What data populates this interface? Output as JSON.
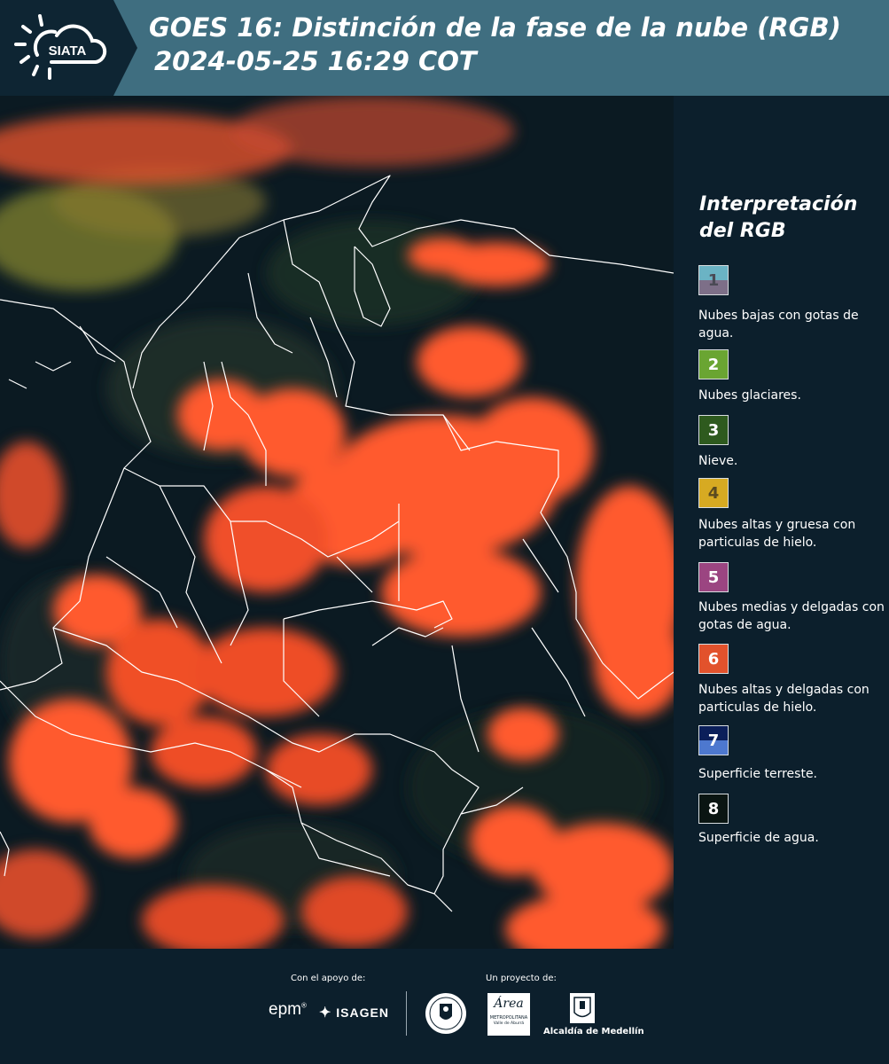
{
  "header": {
    "logo_text": "SIATA",
    "title_line1": "GOES 16: Distinción de la fase de la nube (RGB)",
    "title_line2": "2024-05-25 16:29 COT"
  },
  "legend": {
    "title_line1": "Interpretación",
    "title_line2": "del RGB",
    "items": [
      {
        "num": "1",
        "label": "Nubes bajas con gotas de agua.",
        "color_top": "#6bb3c4",
        "color_bottom": "#7d6f88"
      },
      {
        "num": "2",
        "label": "Nubes glaciares.",
        "color_top": "#6aa532",
        "color_bottom": "#6aa532"
      },
      {
        "num": "3",
        "label": "Nieve.",
        "color_top": "#2e5a1e",
        "color_bottom": "#2e5a1e"
      },
      {
        "num": "4",
        "label": "Nubes altas y gruesa con particulas de hielo.",
        "color_top": "#d7aa22",
        "color_bottom": "#d7aa22"
      },
      {
        "num": "5",
        "label": "Nubes medias y delgadas con gotas de agua.",
        "color_top": "#9b4581",
        "color_bottom": "#9b4581"
      },
      {
        "num": "6",
        "label": "Nubes altas y delgadas con particulas de hielo.",
        "color_top": "#e2522c",
        "color_bottom": "#e2522c"
      },
      {
        "num": "7",
        "label": "Superficie terreste.",
        "color_top": "#0b1f5a",
        "color_bottom": "#4d78cf"
      },
      {
        "num": "8",
        "label": "Superficie de agua.",
        "color_top": "#0a1512",
        "color_bottom": "#0a1512"
      }
    ]
  },
  "footer": {
    "support_label": "Con el apoyo de:",
    "project_label": "Un proyecto de:",
    "epm": "epm",
    "isagen": "ISAGEN",
    "area_text": "Área",
    "metropolitana": "METROPOLITANA",
    "valle": "Valle de Aburrá",
    "alcaldia": "Alcaldía de Medellín"
  },
  "colors": {
    "header_bg": "#3f6e80",
    "page_bg": "#0c1f2c",
    "cloud_orange": "#ff5a2e"
  }
}
